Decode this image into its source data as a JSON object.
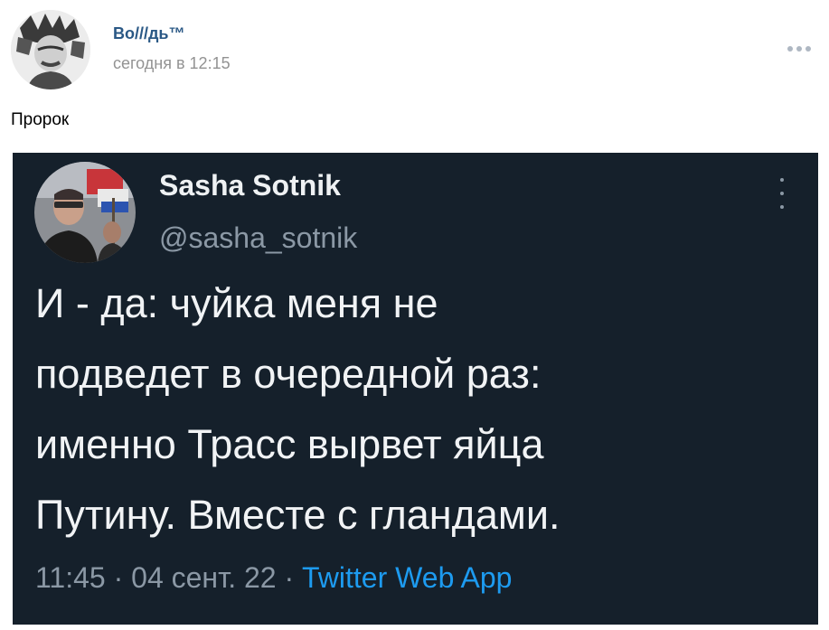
{
  "post": {
    "author": "Во///дь™",
    "time": "сегодня в 12:15",
    "text": "Пророк",
    "more_icon": "more-horizontal-icon"
  },
  "tweet": {
    "name": "Sasha Sotnik",
    "handle": "@sasha_sotnik",
    "lines": [
      "И - да: чуйка меня не",
      "подведет в очередной раз:",
      "именно Трасс вырвет яйца",
      "Путину. Вместе с гландами."
    ],
    "time": "11:45",
    "separator": "·",
    "date": "04 сент. 22",
    "source": "Twitter Web App",
    "more_icon": "more-vertical-icon"
  },
  "colors": {
    "link": "#2a5885",
    "muted": "#939393",
    "tweet_bg": "#15202b",
    "tweet_text": "#f1f3f5",
    "tweet_muted": "#8b98a5",
    "tweet_link": "#1d9bf0"
  }
}
